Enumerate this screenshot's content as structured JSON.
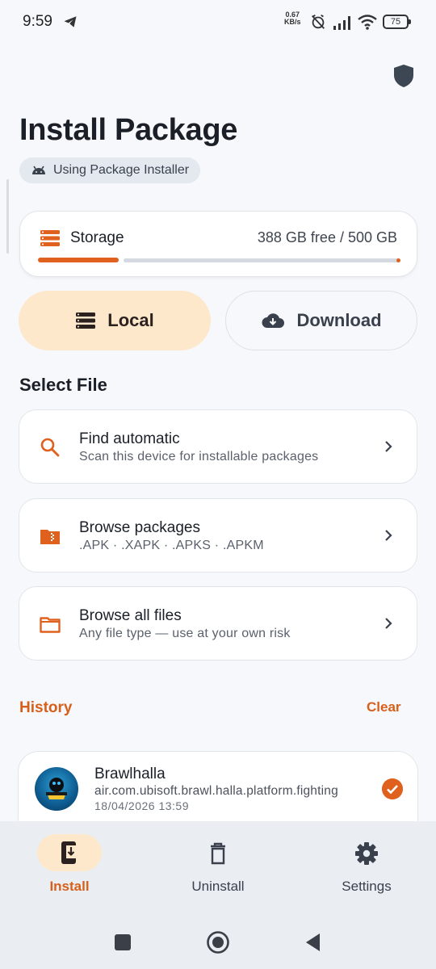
{
  "status_bar": {
    "time": "9:59",
    "net_speed_value": "0.67",
    "net_speed_unit": "KB/s",
    "battery": "75"
  },
  "header": {
    "title": "Install Package",
    "installer_chip": "Using Package Installer"
  },
  "storage": {
    "label": "Storage",
    "value": "388 GB free / 500 GB",
    "used_fraction": 0.224
  },
  "source_tabs": {
    "local": "Local",
    "download": "Download"
  },
  "select_file": {
    "title": "Select File",
    "options": [
      {
        "title": "Find automatic",
        "subtitle": "Scan this device for installable packages"
      },
      {
        "title": "Browse packages",
        "subtitle": ".APK · .XAPK · .APKS · .APKM"
      },
      {
        "title": "Browse all files",
        "subtitle": "Any file type — use at your own risk"
      }
    ]
  },
  "history": {
    "title": "History",
    "clear_label": "Clear",
    "items": [
      {
        "name": "Brawlhalla",
        "package": "air.com.ubisoft.brawl.halla.platform.fighting",
        "date": "18/04/2026 13:59"
      }
    ]
  },
  "bottom_nav": {
    "install": "Install",
    "uninstall": "Uninstall",
    "settings": "Settings"
  },
  "colors": {
    "accent": "#e0601e",
    "accent_soft": "#fee8cc",
    "background": "#f7f8fb"
  }
}
